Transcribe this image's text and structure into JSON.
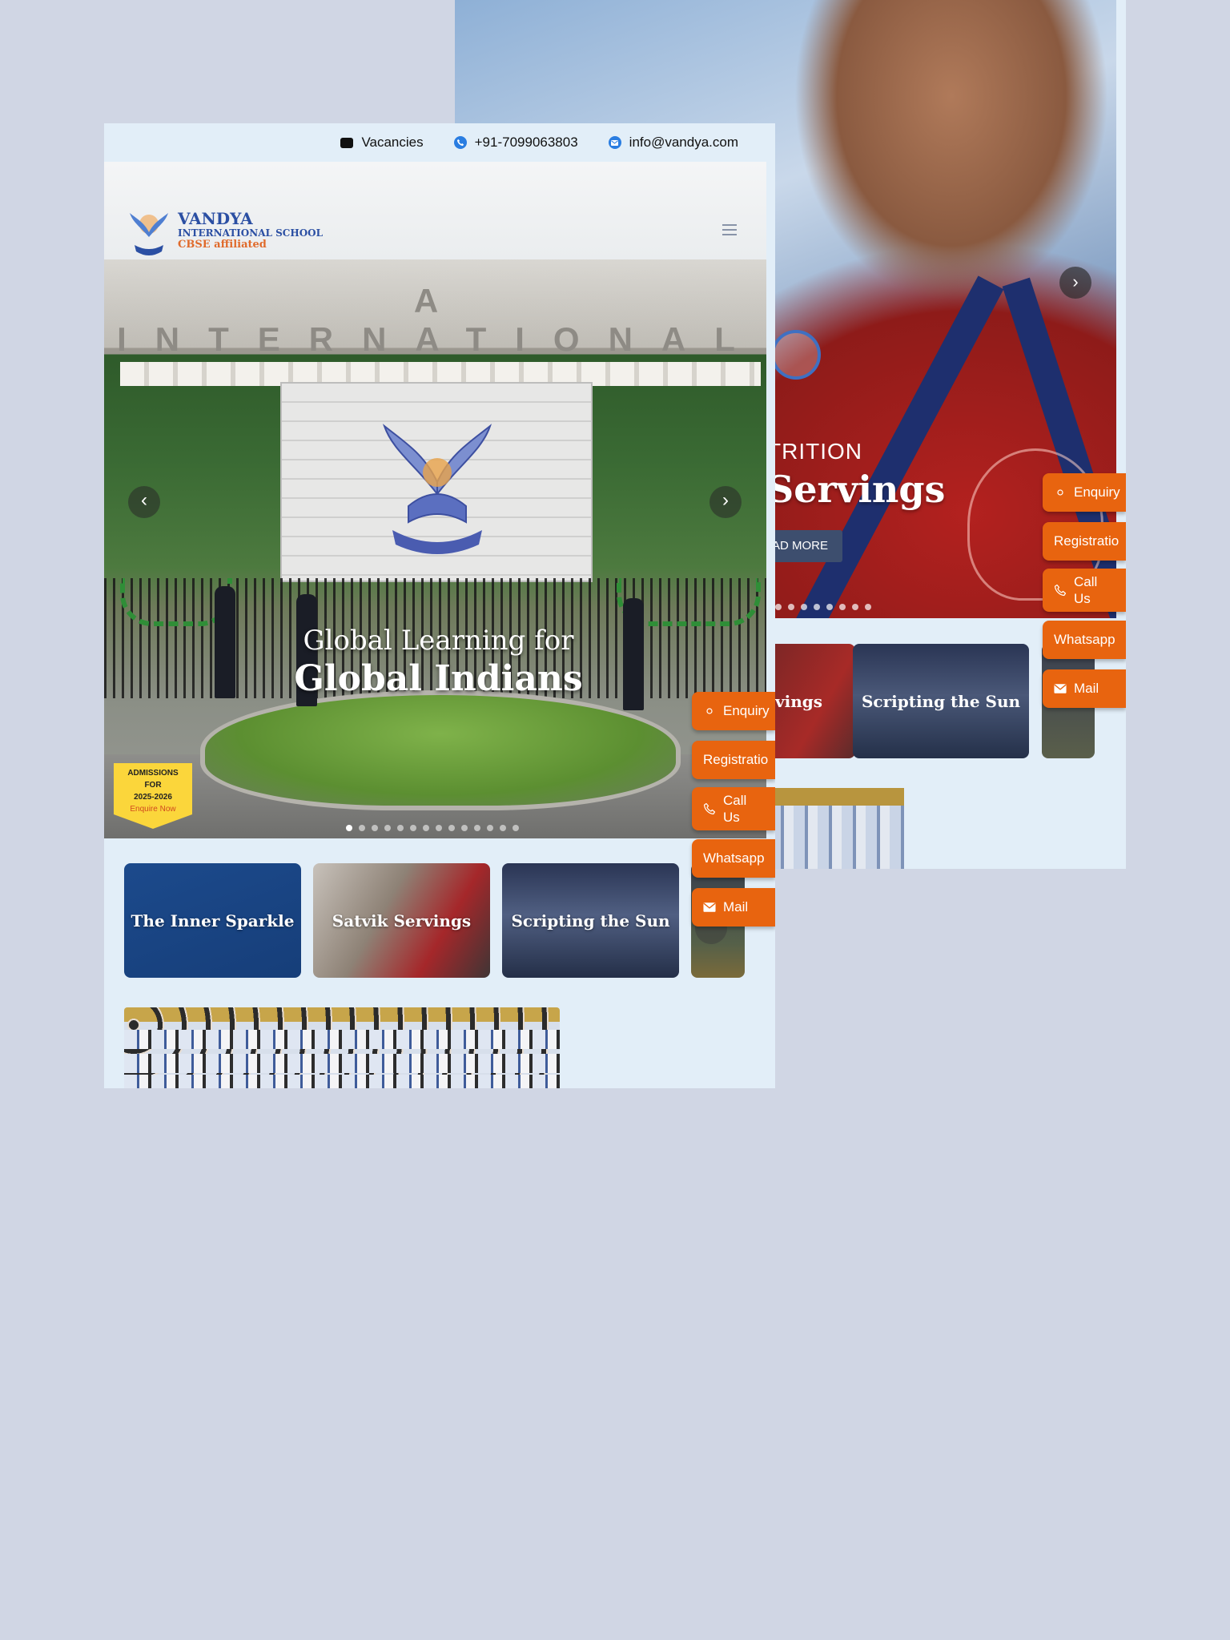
{
  "back": {
    "hero_sub": "TRITION",
    "hero_title": "Servings",
    "read_more": "AD MORE",
    "next_arrow": "›",
    "cards": [
      "vings",
      "Scripting the Sun",
      ""
    ],
    "float_buttons": {
      "enquiry": "Enquiry",
      "registration": "Registratio",
      "call": "Call Us",
      "whatsapp": "Whatsapp",
      "mail": "Mail"
    }
  },
  "topbar": {
    "vacancies": "Vacancies",
    "phone": "+91-7099063803",
    "email": "info@vandya.com"
  },
  "logo": {
    "name": "VANDYA",
    "subtitle": "INTERNATIONAL SCHOOL",
    "affiliation": "CBSE affiliated"
  },
  "hero": {
    "building_text": "A INTERNATIONAL S",
    "title_line1": "Global Learning for",
    "title_line2": "Global Indians",
    "prev_arrow": "‹",
    "next_arrow": "›",
    "slide_count": 14,
    "active_slide": 1
  },
  "admissions": {
    "line1": "ADMISSIONS",
    "line2": "FOR",
    "line3": "2025-2026",
    "cta": "Enquire Now"
  },
  "cards": [
    "The Inner Sparkle",
    "Satvik Servings",
    "Scripting the Sun",
    ""
  ],
  "float_buttons": {
    "enquiry": "Enquiry",
    "registration": "Registratio",
    "call": "Call Us",
    "whatsapp": "Whatsapp",
    "mail": "Mail"
  },
  "colors": {
    "accent_orange": "#e8640f",
    "brand_blue": "#2b4fa3",
    "page_bg": "#e2eef8",
    "admissions_yellow": "#fbd63b"
  },
  "icons": [
    "briefcase-icon",
    "phone-icon",
    "email-icon",
    "hamburger-menu-icon",
    "chevron-left-icon",
    "chevron-right-icon",
    "mail-icon",
    "phone-outline-icon"
  ]
}
